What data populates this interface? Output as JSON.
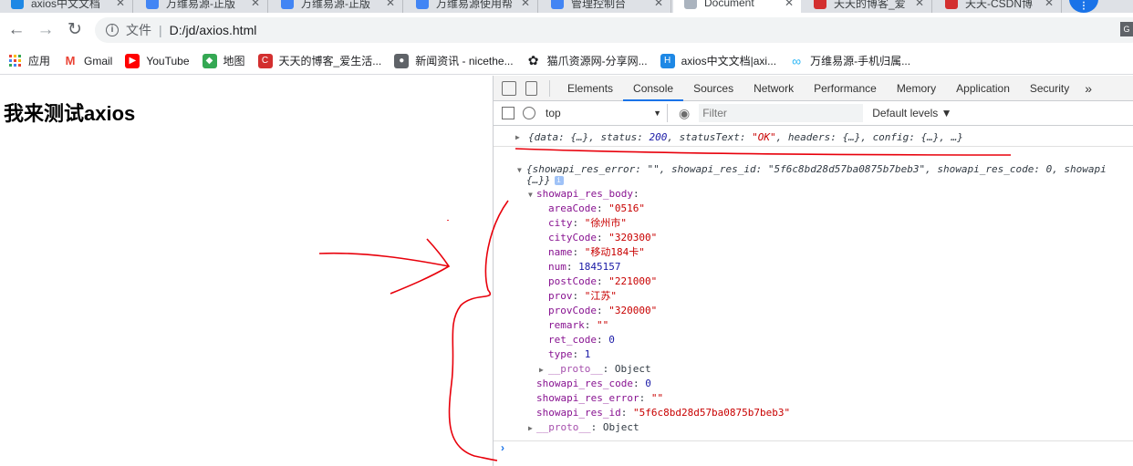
{
  "tabs": [
    {
      "label": "axios中文文档",
      "color": "#1e88e5"
    },
    {
      "label": "万维易源-正版",
      "color": "#4285f4"
    },
    {
      "label": "万维易源-正版",
      "color": "#4285f4"
    },
    {
      "label": "万维易源使用帮",
      "color": "#4285f4"
    },
    {
      "label": "管理控制台",
      "color": "#4285f4"
    },
    {
      "label": "Document",
      "color": "#aab3be",
      "active": true
    },
    {
      "label": "天天的博客_爱",
      "color": "#d32f2f"
    },
    {
      "label": "天天-CSDN博",
      "color": "#d32f2f"
    }
  ],
  "toolbar": {
    "back": "←",
    "forward": "→",
    "reload": "↻",
    "scheme_label": "文件",
    "separator": "|",
    "url": "D:/jd/axios.html"
  },
  "bookmarks": [
    {
      "label": "应用",
      "icon": "apps-icon"
    },
    {
      "label": "Gmail",
      "icon": "gmail-icon",
      "color": "#ea4335",
      "glyph": "M"
    },
    {
      "label": "YouTube",
      "icon": "youtube-icon",
      "color": "#ff0000",
      "glyph": "▶"
    },
    {
      "label": "地图",
      "icon": "maps-icon",
      "color": "#34a853",
      "glyph": "◆"
    },
    {
      "label": "天天的博客_爱生活...",
      "icon": "csdn-icon",
      "color": "#d32f2f",
      "glyph": "C"
    },
    {
      "label": "新闻资讯 - nicethe...",
      "icon": "globe-icon",
      "color": "#5f6368",
      "glyph": "●"
    },
    {
      "label": "猫爪资源网-分享网...",
      "icon": "paw-icon",
      "color": "#202124",
      "glyph": "✿"
    },
    {
      "label": "axios中文文档|axi...",
      "icon": "hexagon-icon",
      "color": "#1e88e5",
      "glyph": "H"
    },
    {
      "label": "万维易源-手机归属...",
      "icon": "infinity-icon",
      "color": "#29b6f6",
      "glyph": "∞"
    }
  ],
  "page": {
    "heading": "我来测试axios"
  },
  "devtools": {
    "tabs": [
      "Elements",
      "Console",
      "Sources",
      "Network",
      "Performance",
      "Memory",
      "Application",
      "Security"
    ],
    "active_tab": "Console",
    "more": "»",
    "context": "top",
    "filter_placeholder": "Filter",
    "levels": "Default levels ▼"
  },
  "console": {
    "row1": [
      {
        "t": "{",
        "c": "k"
      },
      {
        "t": "data",
        "c": "k"
      },
      {
        "t": ": {…}, ",
        "c": "k"
      },
      {
        "t": "status",
        "c": "k"
      },
      {
        "t": ": ",
        "c": "k"
      },
      {
        "t": "200",
        "c": "nv"
      },
      {
        "t": ", ",
        "c": "k"
      },
      {
        "t": "statusText",
        "c": "k"
      },
      {
        "t": ": ",
        "c": "k"
      },
      {
        "t": "\"OK\"",
        "c": "sv"
      },
      {
        "t": ", ",
        "c": "k"
      },
      {
        "t": "headers",
        "c": "k"
      },
      {
        "t": ": {…}, ",
        "c": "k"
      },
      {
        "t": "config",
        "c": "k"
      },
      {
        "t": ": {…}, …}",
        "c": "k"
      }
    ],
    "row2_preview": [
      {
        "t": "{showapi_res_error: ",
        "c": "k"
      },
      {
        "t": "\"\"",
        "c": "sv"
      },
      {
        "t": ", showapi_res_id: ",
        "c": "k"
      },
      {
        "t": "\"5f6c8bd28d57ba0875b7beb3\"",
        "c": "sv"
      },
      {
        "t": ", showapi_res_code: ",
        "c": "k"
      },
      {
        "t": "0",
        "c": "nv"
      },
      {
        "t": ", showapi",
        "c": "k"
      }
    ],
    "row2_more": "{…}}",
    "body_key": "showapi_res_body",
    "body_fields": [
      {
        "k": "areaCode",
        "v": "\"0516\"",
        "c": "sv"
      },
      {
        "k": "city",
        "v": "\"徐州市\"",
        "c": "sv"
      },
      {
        "k": "cityCode",
        "v": "\"320300\"",
        "c": "sv"
      },
      {
        "k": "name",
        "v": "\"移动184卡\"",
        "c": "sv"
      },
      {
        "k": "num",
        "v": "1845157",
        "c": "nv"
      },
      {
        "k": "postCode",
        "v": "\"221000\"",
        "c": "sv"
      },
      {
        "k": "prov",
        "v": "\"江苏\"",
        "c": "sv"
      },
      {
        "k": "provCode",
        "v": "\"320000\"",
        "c": "sv"
      },
      {
        "k": "remark",
        "v": "\"\"",
        "c": "sv"
      },
      {
        "k": "ret_code",
        "v": "0",
        "c": "nv"
      },
      {
        "k": "type",
        "v": "1",
        "c": "nv"
      }
    ],
    "proto_key": "__proto__",
    "proto_val": "Object",
    "top_fields": [
      {
        "k": "showapi_res_code",
        "v": "0",
        "c": "nv"
      },
      {
        "k": "showapi_res_error",
        "v": "\"\"",
        "c": "sv"
      },
      {
        "k": "showapi_res_id",
        "v": "\"5f6c8bd28d57ba0875b7beb3\"",
        "c": "sv"
      }
    ],
    "prompt": "›"
  },
  "colors": {
    "annotation": "#e8000b",
    "accent": "#1a73e8"
  }
}
